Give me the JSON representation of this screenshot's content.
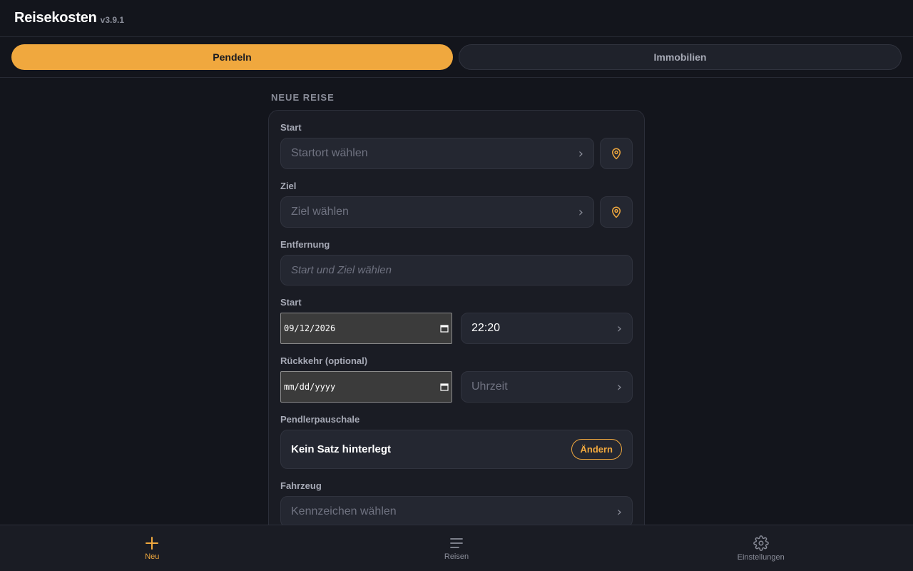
{
  "app": {
    "title": "Reisekosten",
    "version": "v3.9.1"
  },
  "tabs": [
    {
      "label": "Pendeln",
      "active": true
    },
    {
      "label": "Immobilien",
      "active": false
    }
  ],
  "form": {
    "section_title": "NEUE REISE",
    "start_label": "Start",
    "start_placeholder": "Startort wählen",
    "ziel_label": "Ziel",
    "ziel_placeholder": "Ziel wählen",
    "distance_label": "Entfernung",
    "distance_placeholder": "Start und Ziel wählen",
    "start_datetime_label": "Start",
    "start_date": "09/12/2026",
    "start_time": "22:20",
    "return_label": "Rückkehr (optional)",
    "return_date_placeholder": "mm/dd/yyyy",
    "return_time_placeholder": "Uhrzeit",
    "commuter_label": "Pendlerpauschale",
    "commuter_value": "Kein Satz hinterlegt",
    "commuter_change": "Ändern",
    "vehicle_label": "Fahrzeug",
    "vehicle_placeholder": "Kennzeichen wählen"
  },
  "nav": [
    {
      "label": "Neu",
      "icon": "plus-icon",
      "active": true
    },
    {
      "label": "Reisen",
      "icon": "list-icon",
      "active": false
    },
    {
      "label": "Einstellungen",
      "icon": "gear-icon",
      "active": false
    }
  ],
  "colors": {
    "accent": "#f0a83e",
    "background": "#13151c",
    "card": "#1a1c24"
  }
}
